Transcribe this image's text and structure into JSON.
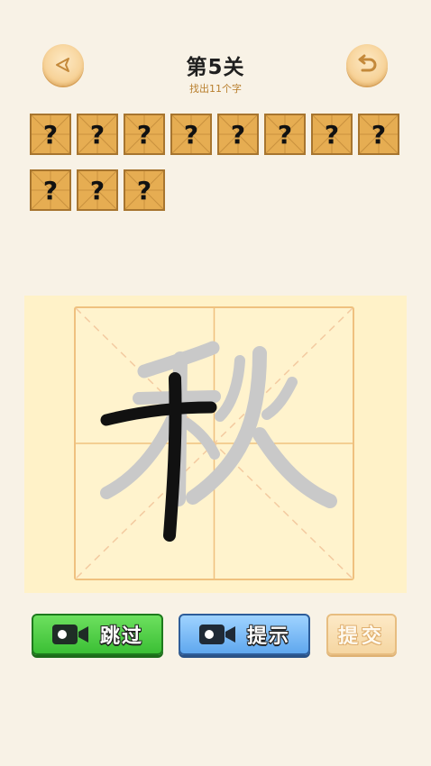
{
  "header": {
    "title": "第5关",
    "subtitle": "找出11个字",
    "back_icon": "triangle-back-icon",
    "undo_icon": "undo-arrow-icon"
  },
  "tiles": [
    "?",
    "?",
    "?",
    "?",
    "?",
    "?",
    "?",
    "?",
    "?",
    "?",
    "?"
  ],
  "canvas": {
    "target_character": "秋"
  },
  "buttons": {
    "skip": "跳过",
    "hint": "提示",
    "submit": "提交"
  },
  "colors": {
    "background": "#f8f2e6",
    "tile": "#e6ad52",
    "skip_button": "#4ccc44",
    "hint_button": "#7dbcf7",
    "submit_button": "#f8ddb0"
  }
}
